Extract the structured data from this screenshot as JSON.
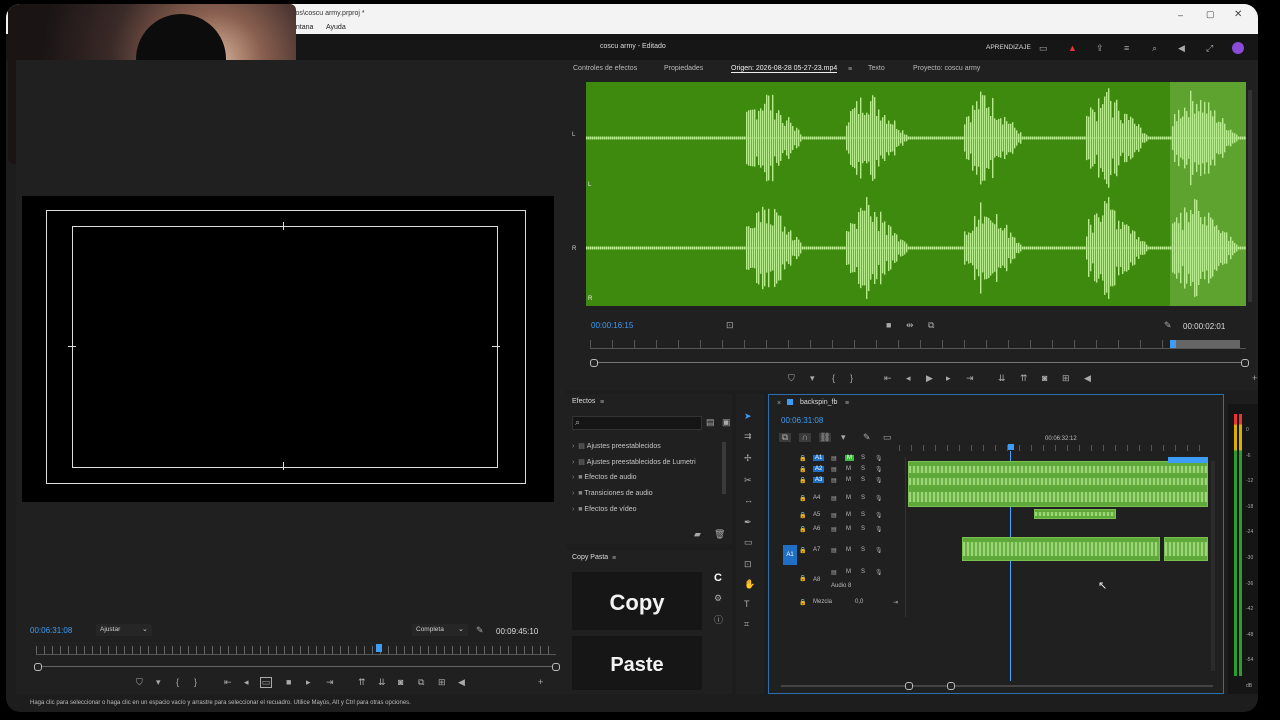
{
  "window": {
    "title_file": "vos\\coscu army.prproj *",
    "menu": [
      "entana",
      "Ayuda"
    ],
    "project_title": "coscu army - Editado",
    "learn_label": "APRENDIZAJE"
  },
  "source_panel": {
    "tabs": [
      "Controles de efectos",
      "Propiedades",
      "Origen: 2026-08-28 05-27-23.mp4",
      "Texto",
      "Proyecto: coscu army"
    ],
    "channel_l": "L",
    "channel_r": "R",
    "timecode_in": "00:00:16:15",
    "timecode_dur": "00:00:02:01",
    "waveform_color": "#3e8a0e",
    "waveform_light": "#b6ec8c"
  },
  "program_panel": {
    "timecode": "00:06:31:08",
    "fit_label": "Ajustar",
    "quality_label": "Completa",
    "duration": "00:09:45:10"
  },
  "effects_panel": {
    "title": "Efectos",
    "items": [
      "Ajustes preestablecidos",
      "Ajustes preestablecidos de Lumetri",
      "Efectos de audio",
      "Transiciones de audio",
      "Efectos de vídeo"
    ]
  },
  "copy_paste": {
    "title": "Copy Pasta",
    "copy_label": "Copy",
    "paste_label": "Paste",
    "logo": "C"
  },
  "timeline": {
    "sequence_name": "backspin_fb",
    "timecode": "00:06:31:08",
    "ruler_label": "00:06:32:12",
    "tracks": [
      {
        "name": "A1",
        "active": true
      },
      {
        "name": "A2",
        "active": true
      },
      {
        "name": "A3",
        "active": true
      },
      {
        "name": "A4",
        "active": false
      },
      {
        "name": "A5",
        "active": false
      },
      {
        "name": "A6",
        "active": false
      },
      {
        "name": "A7",
        "active": false
      },
      {
        "name": "A8",
        "active": false
      }
    ],
    "track_mute": "M",
    "track_solo": "S",
    "audio8_label": "Audio 8",
    "mix_label": "Mezcla",
    "mix_value": "0,0",
    "src_patch": "A1"
  },
  "meter": {
    "scale": [
      "0",
      "-6",
      "-12",
      "-18",
      "-24",
      "-30",
      "-36",
      "-42",
      "-48",
      "-54",
      "dB"
    ]
  },
  "status_bar": {
    "text": "Haga clic para seleccionar o haga clic en un espacio vacío y arrastre para seleccionar el recuadro. Utilice Mayús, Alt y Ctrl para otras opciones."
  },
  "accent": "#3d9cf5"
}
